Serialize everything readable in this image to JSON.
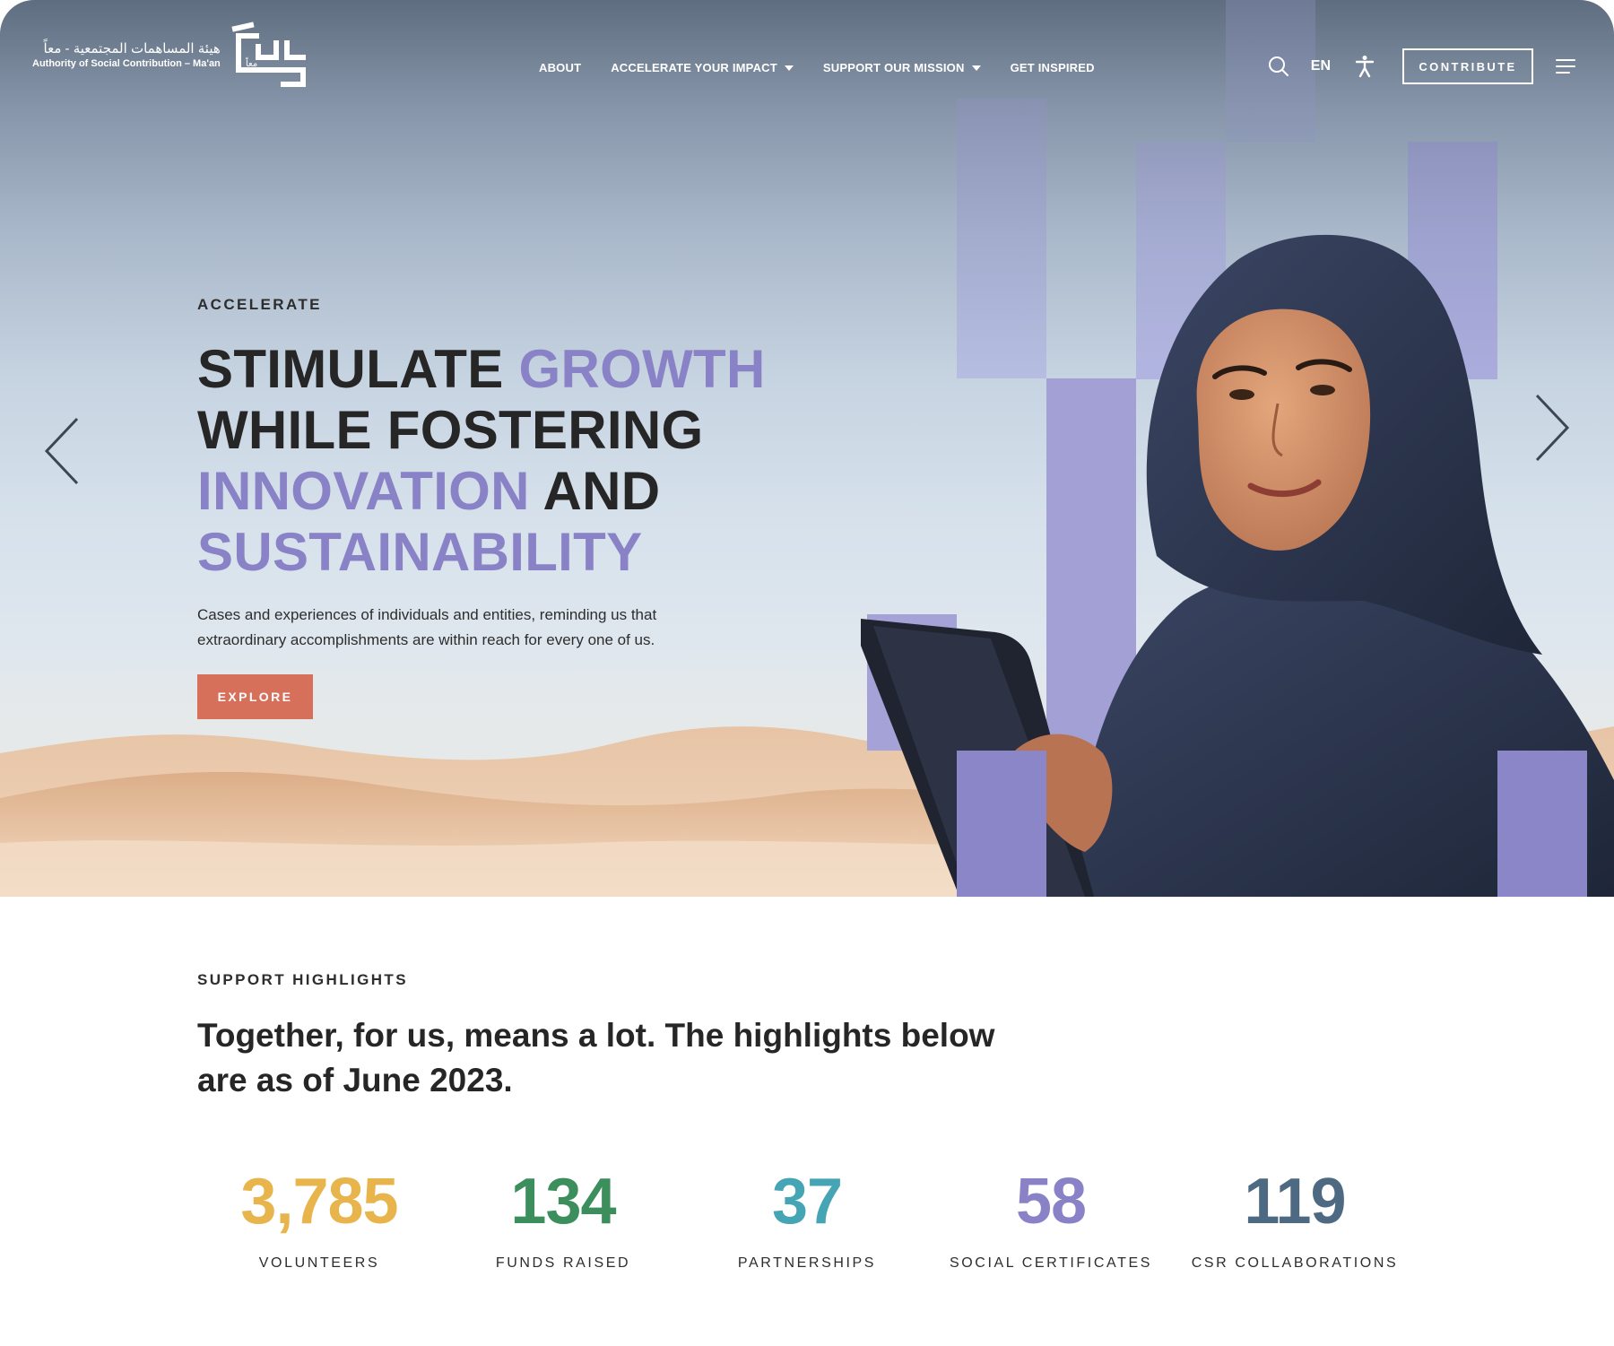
{
  "brand": {
    "name_ar": "هيئة المساهمات المجتمعية - معاً",
    "name_en": "Authority of Social Contribution – Ma'an",
    "mark_ar": "معاً"
  },
  "nav": {
    "items": [
      {
        "label": "ABOUT",
        "has_dropdown": false
      },
      {
        "label": "ACCELERATE YOUR IMPACT",
        "has_dropdown": true
      },
      {
        "label": "SUPPORT OUR MISSION",
        "has_dropdown": true
      },
      {
        "label": "GET INSPIRED",
        "has_dropdown": false
      }
    ]
  },
  "header": {
    "language": "EN",
    "contribute_label": "CONTRIBUTE",
    "icons": [
      "search-icon",
      "accessibility-icon",
      "menu-icon"
    ]
  },
  "hero": {
    "eyebrow": "ACCELERATE",
    "headline": [
      {
        "text": "STIMULATE ",
        "highlight": false
      },
      {
        "text": "GROWTH",
        "highlight": true
      },
      {
        "text": "WHILE FOSTERING",
        "highlight": false
      },
      {
        "text": "INNOVATION",
        "highlight": true
      },
      {
        "text": " AND",
        "highlight": false
      },
      {
        "text": "SUSTAINABILITY",
        "highlight": true
      }
    ],
    "description": "Cases and experiences of individuals and entities, reminding us that extraordinary accomplishments are within reach for every one of us.",
    "cta_label": "EXPLORE",
    "prev_icon": "chevron-left-icon",
    "next_icon": "chevron-right-icon"
  },
  "highlights": {
    "eyebrow": "SUPPORT HIGHLIGHTS",
    "title": "Together, for us, means a lot. The highlights below are as of June 2023.",
    "stats": [
      {
        "value": "3,785",
        "label": "VOLUNTEERS",
        "color": "#e8b44c"
      },
      {
        "value": "134",
        "label": "FUNDS RAISED",
        "color": "#3c8e5c"
      },
      {
        "value": "37",
        "label": "PARTNERSHIPS",
        "color": "#45a5b4"
      },
      {
        "value": "58",
        "label": "SOCIAL CERTIFICATES",
        "color": "#8a82c6"
      },
      {
        "value": "119",
        "label": "CSR COLLABORATIONS",
        "color": "#4e6a82"
      }
    ]
  },
  "colors": {
    "accent_purple": "#8a82c6",
    "cta_coral": "#d6705a",
    "text_dark": "#262626"
  }
}
